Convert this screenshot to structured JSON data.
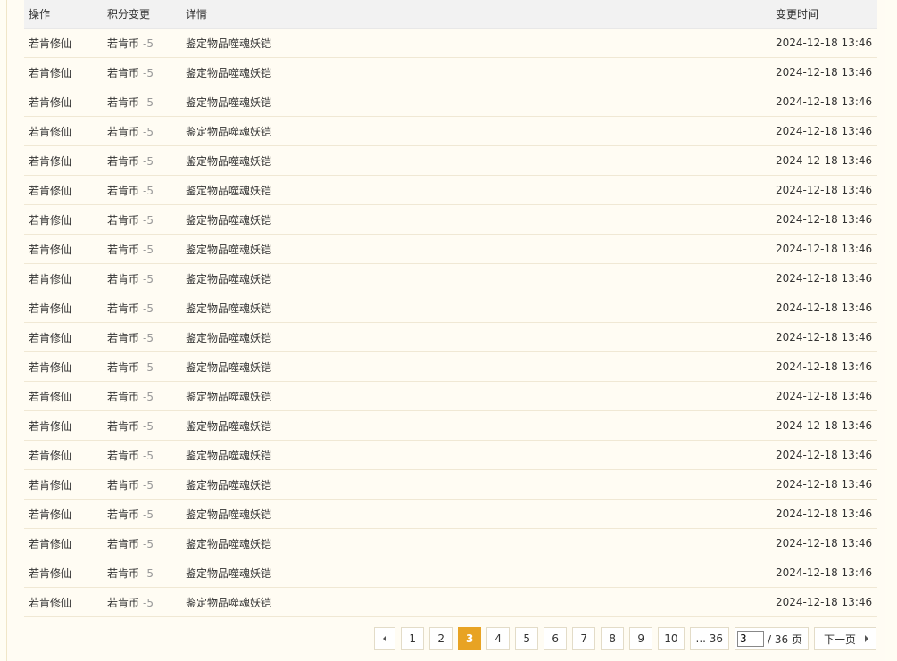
{
  "table": {
    "headers": {
      "action": "操作",
      "points_change": "积分变更",
      "detail": "详情",
      "time": "变更时间"
    },
    "rows": [
      {
        "action": "若肯修仙",
        "currency": "若肯币",
        "delta": "-5",
        "detail": "鉴定物品噬魂妖铠",
        "time": "2024-12-18 13:46"
      },
      {
        "action": "若肯修仙",
        "currency": "若肯币",
        "delta": "-5",
        "detail": "鉴定物品噬魂妖铠",
        "time": "2024-12-18 13:46"
      },
      {
        "action": "若肯修仙",
        "currency": "若肯币",
        "delta": "-5",
        "detail": "鉴定物品噬魂妖铠",
        "time": "2024-12-18 13:46"
      },
      {
        "action": "若肯修仙",
        "currency": "若肯币",
        "delta": "-5",
        "detail": "鉴定物品噬魂妖铠",
        "time": "2024-12-18 13:46"
      },
      {
        "action": "若肯修仙",
        "currency": "若肯币",
        "delta": "-5",
        "detail": "鉴定物品噬魂妖铠",
        "time": "2024-12-18 13:46"
      },
      {
        "action": "若肯修仙",
        "currency": "若肯币",
        "delta": "-5",
        "detail": "鉴定物品噬魂妖铠",
        "time": "2024-12-18 13:46"
      },
      {
        "action": "若肯修仙",
        "currency": "若肯币",
        "delta": "-5",
        "detail": "鉴定物品噬魂妖铠",
        "time": "2024-12-18 13:46"
      },
      {
        "action": "若肯修仙",
        "currency": "若肯币",
        "delta": "-5",
        "detail": "鉴定物品噬魂妖铠",
        "time": "2024-12-18 13:46"
      },
      {
        "action": "若肯修仙",
        "currency": "若肯币",
        "delta": "-5",
        "detail": "鉴定物品噬魂妖铠",
        "time": "2024-12-18 13:46"
      },
      {
        "action": "若肯修仙",
        "currency": "若肯币",
        "delta": "-5",
        "detail": "鉴定物品噬魂妖铠",
        "time": "2024-12-18 13:46"
      },
      {
        "action": "若肯修仙",
        "currency": "若肯币",
        "delta": "-5",
        "detail": "鉴定物品噬魂妖铠",
        "time": "2024-12-18 13:46"
      },
      {
        "action": "若肯修仙",
        "currency": "若肯币",
        "delta": "-5",
        "detail": "鉴定物品噬魂妖铠",
        "time": "2024-12-18 13:46"
      },
      {
        "action": "若肯修仙",
        "currency": "若肯币",
        "delta": "-5",
        "detail": "鉴定物品噬魂妖铠",
        "time": "2024-12-18 13:46"
      },
      {
        "action": "若肯修仙",
        "currency": "若肯币",
        "delta": "-5",
        "detail": "鉴定物品噬魂妖铠",
        "time": "2024-12-18 13:46"
      },
      {
        "action": "若肯修仙",
        "currency": "若肯币",
        "delta": "-5",
        "detail": "鉴定物品噬魂妖铠",
        "time": "2024-12-18 13:46"
      },
      {
        "action": "若肯修仙",
        "currency": "若肯币",
        "delta": "-5",
        "detail": "鉴定物品噬魂妖铠",
        "time": "2024-12-18 13:46"
      },
      {
        "action": "若肯修仙",
        "currency": "若肯币",
        "delta": "-5",
        "detail": "鉴定物品噬魂妖铠",
        "time": "2024-12-18 13:46"
      },
      {
        "action": "若肯修仙",
        "currency": "若肯币",
        "delta": "-5",
        "detail": "鉴定物品噬魂妖铠",
        "time": "2024-12-18 13:46"
      },
      {
        "action": "若肯修仙",
        "currency": "若肯币",
        "delta": "-5",
        "detail": "鉴定物品噬魂妖铠",
        "time": "2024-12-18 13:46"
      },
      {
        "action": "若肯修仙",
        "currency": "若肯币",
        "delta": "-5",
        "detail": "鉴定物品噬魂妖铠",
        "time": "2024-12-18 13:46"
      }
    ]
  },
  "pagination": {
    "prev_icon": "triangle-left-icon",
    "pages": [
      "1",
      "2",
      "3",
      "4",
      "5",
      "6",
      "7",
      "8",
      "9",
      "10"
    ],
    "current_page": "3",
    "last_page_label": "... 36",
    "jump_value": "3",
    "total_label": "/ 36 页",
    "next_label": "下一页",
    "next_icon": "triangle-right-icon"
  },
  "colors": {
    "current_page_bg": "#e8a323",
    "page_bg": "#fffcf3",
    "header_bg": "#f2f2f2",
    "delta_text": "#999999"
  }
}
